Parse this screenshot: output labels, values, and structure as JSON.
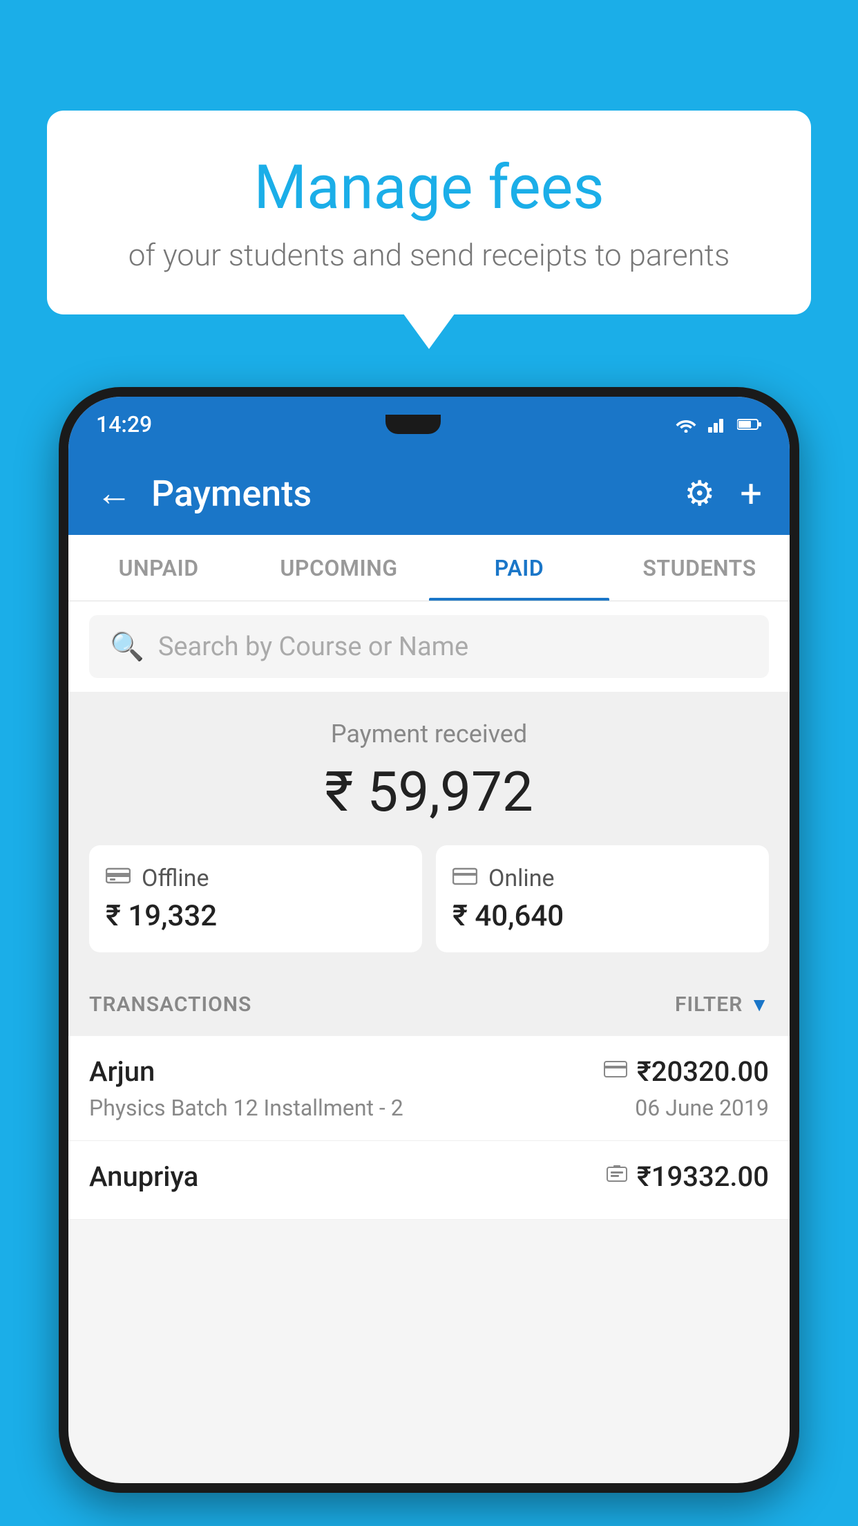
{
  "background_color": "#1BAEE8",
  "bubble": {
    "title": "Manage fees",
    "subtitle": "of your students and send receipts to parents"
  },
  "status_bar": {
    "time": "14:29"
  },
  "app_bar": {
    "title": "Payments",
    "back_label": "←",
    "gear_label": "⚙",
    "plus_label": "+"
  },
  "tabs": [
    {
      "label": "UNPAID",
      "active": false
    },
    {
      "label": "UPCOMING",
      "active": false
    },
    {
      "label": "PAID",
      "active": true
    },
    {
      "label": "STUDENTS",
      "active": false
    }
  ],
  "search": {
    "placeholder": "Search by Course or Name"
  },
  "payment_summary": {
    "received_label": "Payment received",
    "total_amount": "₹ 59,972",
    "offline": {
      "label": "Offline",
      "amount": "₹ 19,332"
    },
    "online": {
      "label": "Online",
      "amount": "₹ 40,640"
    }
  },
  "transactions": {
    "header_label": "TRANSACTIONS",
    "filter_label": "FILTER",
    "rows": [
      {
        "name": "Arjun",
        "amount": "₹20320.00",
        "type_icon": "card",
        "course": "Physics Batch 12 Installment - 2",
        "date": "06 June 2019"
      },
      {
        "name": "Anupriya",
        "amount": "₹19332.00",
        "type_icon": "cash",
        "course": "",
        "date": ""
      }
    ]
  }
}
